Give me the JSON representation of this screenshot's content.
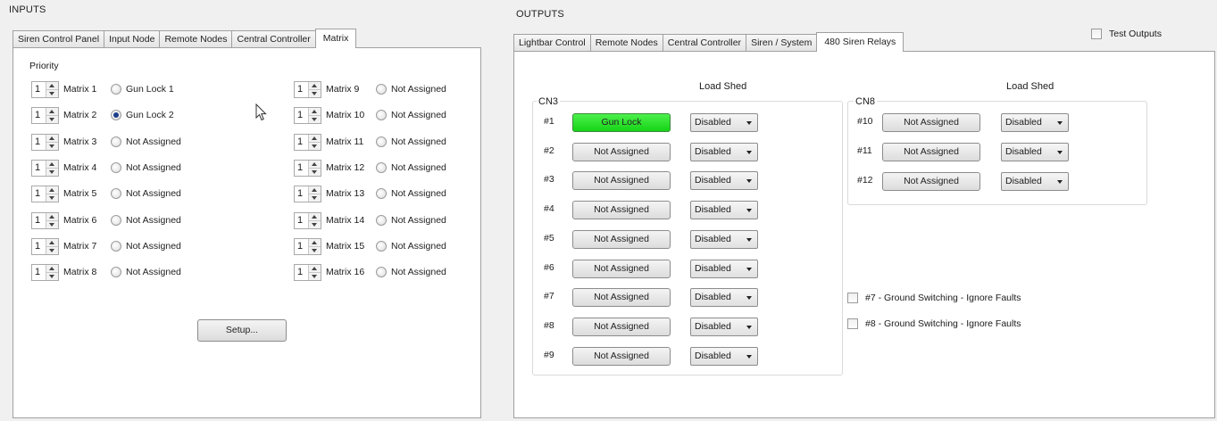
{
  "inputs": {
    "title": "INPUTS",
    "tabs": [
      "Siren Control Panel",
      "Input Node",
      "Remote Nodes",
      "Central Controller",
      "Matrix"
    ],
    "active_tab": 4,
    "priority_label": "Priority",
    "matrix_rows": [
      {
        "value": "1",
        "label": "Matrix 1",
        "assigned": "Gun Lock 1",
        "selected": false
      },
      {
        "value": "1",
        "label": "Matrix 2",
        "assigned": "Gun Lock 2",
        "selected": true
      },
      {
        "value": "1",
        "label": "Matrix 3",
        "assigned": "Not Assigned",
        "selected": false
      },
      {
        "value": "1",
        "label": "Matrix 4",
        "assigned": "Not Assigned",
        "selected": false
      },
      {
        "value": "1",
        "label": "Matrix 5",
        "assigned": "Not Assigned",
        "selected": false
      },
      {
        "value": "1",
        "label": "Matrix 6",
        "assigned": "Not Assigned",
        "selected": false
      },
      {
        "value": "1",
        "label": "Matrix 7",
        "assigned": "Not Assigned",
        "selected": false
      },
      {
        "value": "1",
        "label": "Matrix 8",
        "assigned": "Not Assigned",
        "selected": false
      },
      {
        "value": "1",
        "label": "Matrix 9",
        "assigned": "Not Assigned",
        "selected": false
      },
      {
        "value": "1",
        "label": "Matrix 10",
        "assigned": "Not Assigned",
        "selected": false
      },
      {
        "value": "1",
        "label": "Matrix 11",
        "assigned": "Not Assigned",
        "selected": false
      },
      {
        "value": "1",
        "label": "Matrix 12",
        "assigned": "Not Assigned",
        "selected": false
      },
      {
        "value": "1",
        "label": "Matrix 13",
        "assigned": "Not Assigned",
        "selected": false
      },
      {
        "value": "1",
        "label": "Matrix 14",
        "assigned": "Not Assigned",
        "selected": false
      },
      {
        "value": "1",
        "label": "Matrix 15",
        "assigned": "Not Assigned",
        "selected": false
      },
      {
        "value": "1",
        "label": "Matrix 16",
        "assigned": "Not Assigned",
        "selected": false
      }
    ],
    "setup_button": "Setup..."
  },
  "outputs": {
    "title": "OUTPUTS",
    "tabs": [
      "Lightbar Control",
      "Remote Nodes",
      "Central Controller",
      "Siren / System",
      "480 Siren Relays"
    ],
    "active_tab": 4,
    "test_outputs_label": "Test Outputs",
    "load_shed_label": "Load Shed",
    "cn3": {
      "label": "CN3",
      "relays": [
        {
          "num": "#1",
          "assign": "Gun Lock",
          "shed": "Disabled",
          "active": true
        },
        {
          "num": "#2",
          "assign": "Not Assigned",
          "shed": "Disabled",
          "active": false
        },
        {
          "num": "#3",
          "assign": "Not Assigned",
          "shed": "Disabled",
          "active": false
        },
        {
          "num": "#4",
          "assign": "Not Assigned",
          "shed": "Disabled",
          "active": false
        },
        {
          "num": "#5",
          "assign": "Not Assigned",
          "shed": "Disabled",
          "active": false
        },
        {
          "num": "#6",
          "assign": "Not Assigned",
          "shed": "Disabled",
          "active": false
        },
        {
          "num": "#7",
          "assign": "Not Assigned",
          "shed": "Disabled",
          "active": false
        },
        {
          "num": "#8",
          "assign": "Not Assigned",
          "shed": "Disabled",
          "active": false
        },
        {
          "num": "#9",
          "assign": "Not Assigned",
          "shed": "Disabled",
          "active": false
        }
      ]
    },
    "cn8": {
      "label": "CN8",
      "relays": [
        {
          "num": "#10",
          "assign": "Not Assigned",
          "shed": "Disabled"
        },
        {
          "num": "#11",
          "assign": "Not Assigned",
          "shed": "Disabled"
        },
        {
          "num": "#12",
          "assign": "Not Assigned",
          "shed": "Disabled"
        }
      ]
    },
    "ground_switching": [
      {
        "label": "#7 - Ground Switching - Ignore Faults",
        "checked": false
      },
      {
        "label": "#8 - Ground Switching - Ignore Faults",
        "checked": false
      }
    ]
  },
  "colors": {
    "active_relay": "#22dd22",
    "radio_dot": "#1c3e8a"
  }
}
